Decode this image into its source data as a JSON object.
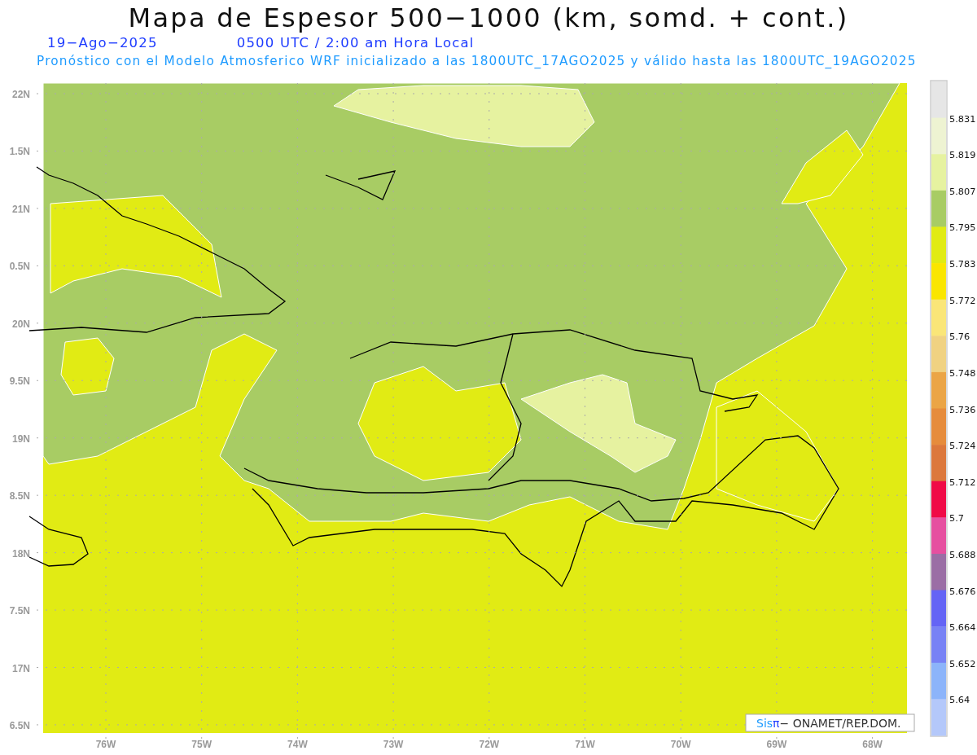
{
  "title": "Mapa de Espesor 500−1000 (km, somd. + cont.)",
  "date": "19−Ago−2025",
  "time": "0500 UTC / 2:00 am Hora Local",
  "subtitle": "Pronóstico con el Modelo Atmosferico WRF inicializado a las 1800UTC_17AGO2025 y válido hasta las  1800UTC_19AGO2025",
  "y_axis_labels": [
    "22N",
    "1.5N",
    "21N",
    "0.5N",
    "20N",
    "9.5N",
    "19N",
    "8.5N",
    "18N",
    "7.5N",
    "17N",
    "6.5N"
  ],
  "x_axis_labels": [
    "76W",
    "75W",
    "74W",
    "73W",
    "72W",
    "71W",
    "70W",
    "69W",
    "68W"
  ],
  "colorbar": {
    "segments": [
      {
        "color": "#e6e6e6"
      },
      {
        "color": "#eef3d2"
      },
      {
        "color": "#e6f2a0"
      },
      {
        "color": "#a8cc64"
      },
      {
        "color": "#e1eb14"
      },
      {
        "color": "#fae600"
      },
      {
        "color": "#fae678"
      },
      {
        "color": "#f0d282"
      },
      {
        "color": "#eba546"
      },
      {
        "color": "#e68c3c"
      },
      {
        "color": "#dc783c"
      },
      {
        "color": "#f00a46"
      },
      {
        "color": "#e650a0"
      },
      {
        "color": "#9b6ea5"
      },
      {
        "color": "#6464f5"
      },
      {
        "color": "#7882f5"
      },
      {
        "color": "#8cb4fa"
      },
      {
        "color": "#b4c8fa"
      }
    ],
    "labels": [
      "5.831",
      "5.819",
      "5.807",
      "5.795",
      "5.783",
      "5.772",
      "5.76",
      "5.748",
      "5.736",
      "5.724",
      "5.712",
      "5.7",
      "5.688",
      "5.676",
      "5.664",
      "5.652",
      "5.64"
    ]
  },
  "credit": {
    "brand": "Sis",
    "symbol": "π",
    "text": "− ONAMET/REP.DOM."
  }
}
